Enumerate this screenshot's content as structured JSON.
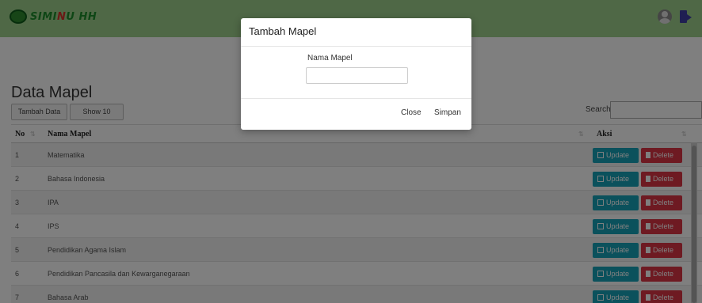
{
  "navbar": {
    "brand_prefix": "SIMI",
    "brand_highlight": "N",
    "brand_suffix": "U HH",
    "icons": [
      "user-icon",
      "logout-icon"
    ]
  },
  "page": {
    "title": "Data Mapel",
    "add_button": "Tambah Data",
    "rows_button": "Show 10 rows",
    "search_label": "Search:",
    "search_value": ""
  },
  "table": {
    "columns": [
      "No",
      "Nama Mapel",
      "Aksi"
    ],
    "update_label": "Update",
    "delete_label": "Delete",
    "rows": [
      {
        "no": "1",
        "name": "Matematika"
      },
      {
        "no": "2",
        "name": "Bahasa Indonesia"
      },
      {
        "no": "3",
        "name": "IPA"
      },
      {
        "no": "4",
        "name": "IPS"
      },
      {
        "no": "5",
        "name": "Pendidikan Agama Islam"
      },
      {
        "no": "6",
        "name": "Pendidikan Pancasila dan Kewarganegaraan"
      },
      {
        "no": "7",
        "name": "Bahasa Arab"
      }
    ]
  },
  "modal": {
    "title": "Tambah Mapel",
    "field_label": "Nama Mapel",
    "field_value": "",
    "close_label": "Close",
    "save_label": "Simpan"
  },
  "colors": {
    "navbar": "#9fd18d",
    "update": "#17a2b8",
    "delete": "#dc3545"
  }
}
